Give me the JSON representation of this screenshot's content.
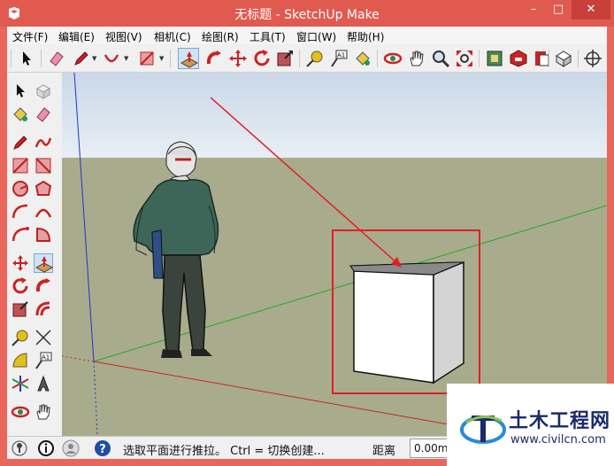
{
  "window": {
    "title": "无标题 - SketchUp Make",
    "minimize_label": "–",
    "maximize_label": "□",
    "close_label": "✕"
  },
  "menu": {
    "items": [
      "文件(F)",
      "编辑(E)",
      "视图(V)",
      "相机(C)",
      "绘图(R)",
      "工具(T)",
      "窗口(W)",
      "帮助(H)"
    ]
  },
  "toolbar": {
    "buttons": [
      "select-icon",
      "eraser-icon",
      "pencil-icon",
      "arc-icon",
      "shapes-icon",
      "push-pull-icon",
      "follow-me-icon",
      "move-icon",
      "rotate-icon",
      "scale-icon",
      "tape-measure-icon",
      "text-icon",
      "paint-bucket-icon",
      "orbit-icon",
      "pan-icon",
      "zoom-icon",
      "zoom-extents-icon",
      "warehouse-icon",
      "extension-warehouse-icon",
      "layout-icon",
      "components-icon",
      "axes-icon"
    ],
    "active_tool": "push-pull-icon"
  },
  "left_toolbar": {
    "tools": [
      "select-icon",
      "component-icon",
      "paint-bucket-icon",
      "eraser-icon",
      "line-icon",
      "freehand-icon",
      "rectangle-icon",
      "rotated-rectangle-icon",
      "circle-icon",
      "polygon-icon",
      "arc-icon",
      "two-point-arc-icon",
      "three-point-arc-icon",
      "pie-icon",
      "move-icon",
      "push-pull-icon",
      "rotate-icon",
      "follow-me-icon",
      "scale-icon",
      "offset-icon",
      "tape-measure-icon",
      "dimension-icon",
      "protractor-icon",
      "text-icon",
      "axes-icon",
      "3d-text-icon",
      "orbit-icon",
      "pan-icon"
    ]
  },
  "statusbar": {
    "hint": "选取平面进行推拉。 Ctrl = 切换创建...",
    "measure_label": "距离",
    "measure_value": "0.00m"
  },
  "watermark": {
    "title": "土木工程网",
    "url": "www.civilcn.com"
  },
  "colors": {
    "titlebar": "#e05a50",
    "sky": "#dce6f0",
    "ground": "#a8ac8c",
    "highlight_red": "#e02020",
    "axis_green": "#22aa22",
    "axis_blue": "#2233cc",
    "axis_red": "#cc2222"
  }
}
